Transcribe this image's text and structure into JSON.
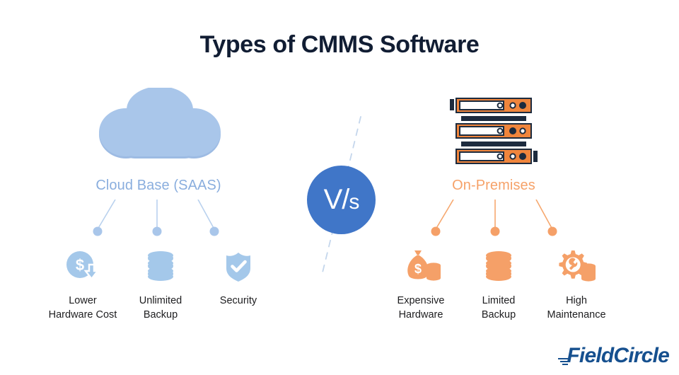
{
  "page": {
    "title": "Types of CMMS Software",
    "background": "#ffffff"
  },
  "colors": {
    "title_navy": "#111d33",
    "cloud_blue": "#a4c2e8",
    "cloud_label_blue": "#8aaede",
    "icon_blue": "#a4c8ea",
    "vs_circle_blue": "#4076c8",
    "orange": "#f5a068",
    "orange_label": "#f6a269",
    "server_dark": "#1d2b3e",
    "label_text": "#1d1d1f",
    "logo_blue": "#16508f"
  },
  "comparison": {
    "divider": {
      "label": "V/S",
      "label_main": "V",
      "label_slash": "/",
      "label_sub": "s",
      "icon": "vs-badge-icon"
    },
    "left": {
      "heading": "Cloud Base (SAAS)",
      "graphic_icon": "cloud-icon",
      "features": [
        {
          "icon": "dollar-down-arrow-icon",
          "label": "Lower\nHardware Cost"
        },
        {
          "icon": "database-stack-icon",
          "label": "Unlimited\nBackup"
        },
        {
          "icon": "shield-check-icon",
          "label": "Security"
        }
      ]
    },
    "right": {
      "heading": "On-Premises",
      "graphic_icon": "server-rack-icon",
      "features": [
        {
          "icon": "money-bag-coins-icon",
          "label": "Expensive\nHardware"
        },
        {
          "icon": "database-stack-icon",
          "label": "Limited\nBackup"
        },
        {
          "icon": "gear-wrench-coins-icon",
          "label": "High\nMaintenance"
        }
      ]
    }
  },
  "footer": {
    "logo_text": "FieldCircle",
    "logo_icon": "fieldcircle-speedlines-icon"
  }
}
